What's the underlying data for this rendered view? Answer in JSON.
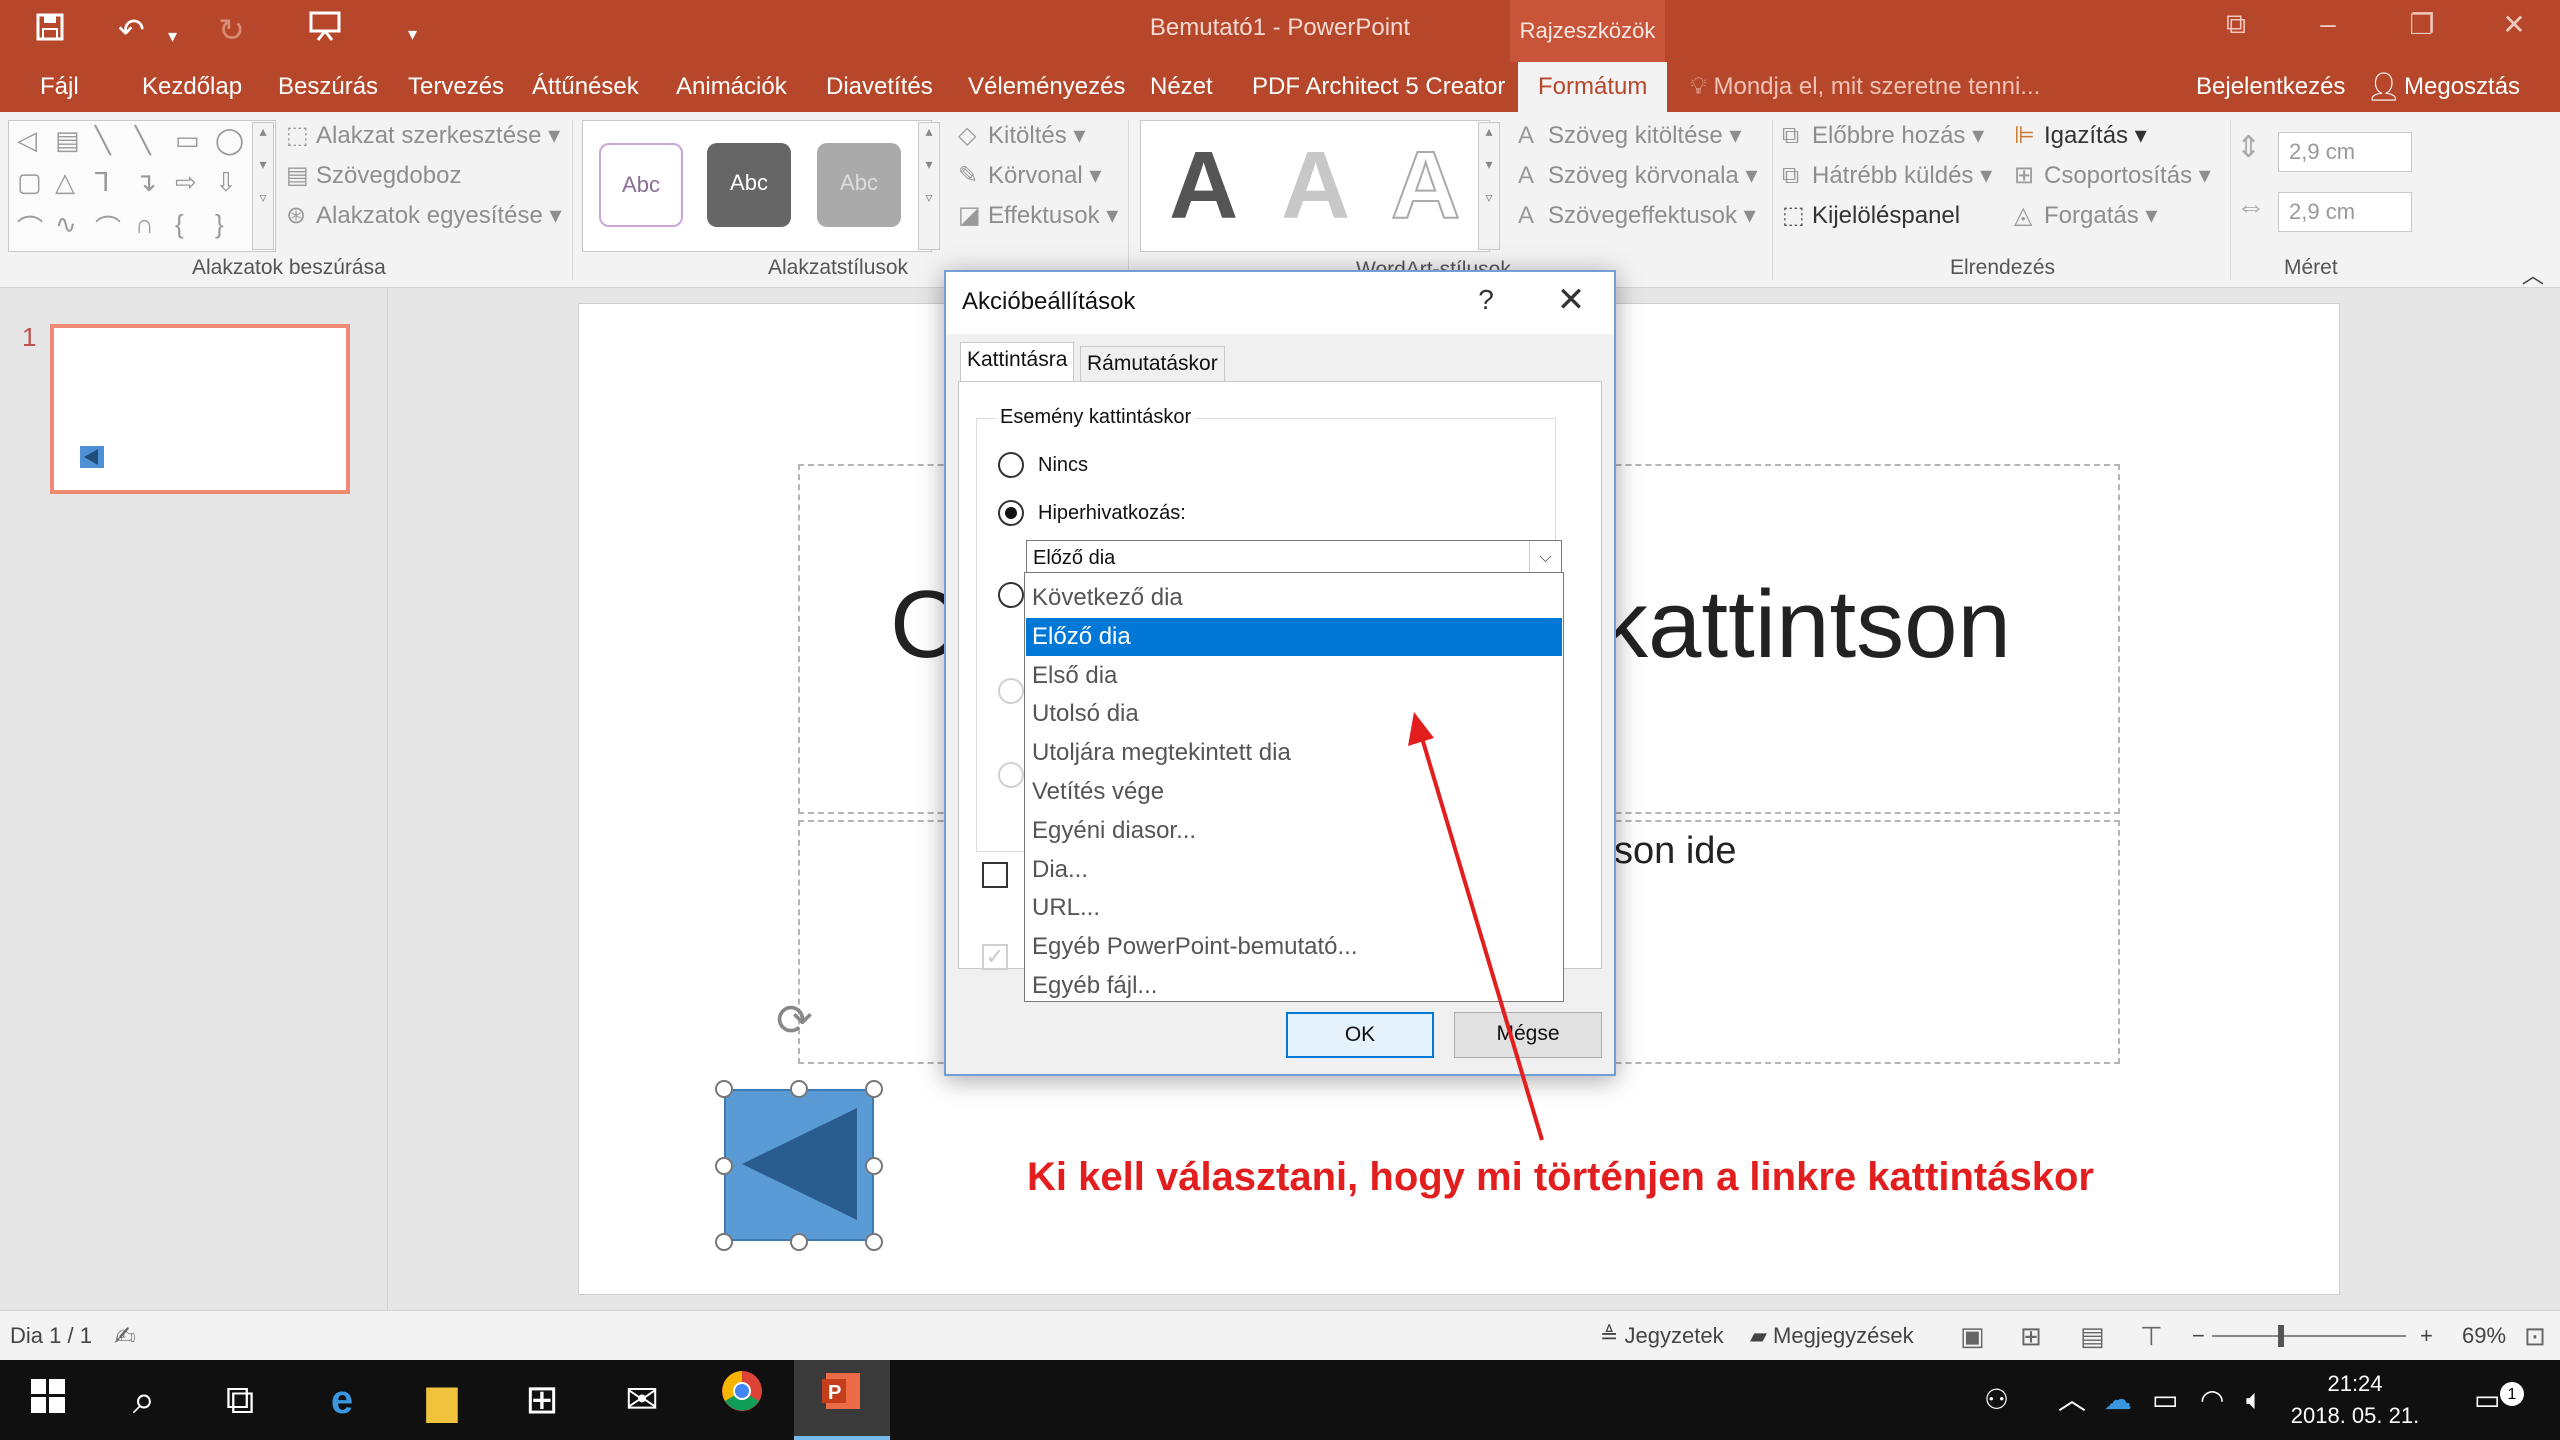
{
  "app": {
    "title": "Bemutató1 - PowerPoint",
    "context_tab": "Rajzeszközök"
  },
  "quick_access": {
    "save_icon": "save-icon",
    "undo_icon": "undo-icon",
    "redo_icon": "redo-icon",
    "present_icon": "present-from-start-icon",
    "customize_icon": "customize-dropdown-icon"
  },
  "ribbon_tabs": [
    "Fájl",
    "Kezdőlap",
    "Beszúrás",
    "Tervezés",
    "Áttűnések",
    "Animációk",
    "Diavetítés",
    "Véleményezés",
    "Nézet",
    "PDF Architect 5 Creator",
    "Formátum"
  ],
  "tell_me": "Mondja el, mit szeretne tenni...",
  "sign_in": "Bejelentkezés",
  "share": "Megosztás",
  "ribbon": {
    "insert_shapes": {
      "label": "Alakzatok beszúrása",
      "edit_shape": "Alakzat szerkesztése",
      "text_box": "Szövegdoboz",
      "merge_shapes": "Alakzatok egyesítése"
    },
    "shape_styles": {
      "label": "Alakzatstílusok",
      "sample": "Abc",
      "fill": "Kitöltés",
      "outline": "Körvonal",
      "effects": "Effektusok"
    },
    "wordart": {
      "label": "WordArt-stílusok",
      "sample": "A",
      "text_fill": "Szöveg kitöltése",
      "text_outline": "Szöveg körvonala",
      "text_effects": "Szövegeffektusok"
    },
    "arrange": {
      "label": "Elrendezés",
      "bring_forward": "Előbbre hozás",
      "send_backward": "Hátrébb küldés",
      "selection_pane": "Kijelöléspanel",
      "align": "Igazítás",
      "group": "Csoportosítás",
      "rotate": "Forgatás"
    },
    "size": {
      "label": "Méret",
      "height": "2,9 cm",
      "width": "2,9 cm"
    }
  },
  "thumbnails": [
    {
      "number": "1"
    }
  ],
  "slide": {
    "title_left": "C",
    "title_right": "kattintson",
    "subtitle_right": "son ide"
  },
  "dialog": {
    "title": "Akcióbeállítások",
    "help": "?",
    "close": "✕",
    "tabs": [
      "Kattintásra",
      "Rámutatáskor"
    ],
    "group_label": "Esemény kattintáskor",
    "option_none": "Nincs",
    "option_hyperlink": "Hiperhivatkozás:",
    "hyperlink_value": "Előző dia",
    "ok": "OK",
    "cancel": "Mégse"
  },
  "dropdown": {
    "options": [
      "Következő dia",
      "Előző dia",
      "Első dia",
      "Utolsó dia",
      "Utoljára megtekintett dia",
      "Vetítés vége",
      "Egyéni diasor...",
      "Dia...",
      "URL...",
      "Egyéb PowerPoint-bemutató...",
      "Egyéb fájl..."
    ],
    "selected_index": 1
  },
  "annotation": {
    "text": "Ki kell választani, hogy mi történjen a linkre kattintáskor",
    "color": "#e21e1e"
  },
  "statusbar": {
    "slide_counter": "Dia 1 / 1",
    "notes": "Jegyzetek",
    "comments": "Megjegyzések",
    "zoom_minus": "−",
    "zoom_plus": "+",
    "zoom": "69%"
  },
  "taskbar": {
    "time": "21:24",
    "date": "2018. 05. 21.",
    "notification_count": "1"
  },
  "colors": {
    "accent": "#b7472a",
    "selection": "#0078d7",
    "shape_fill": "#5b9bd5"
  }
}
